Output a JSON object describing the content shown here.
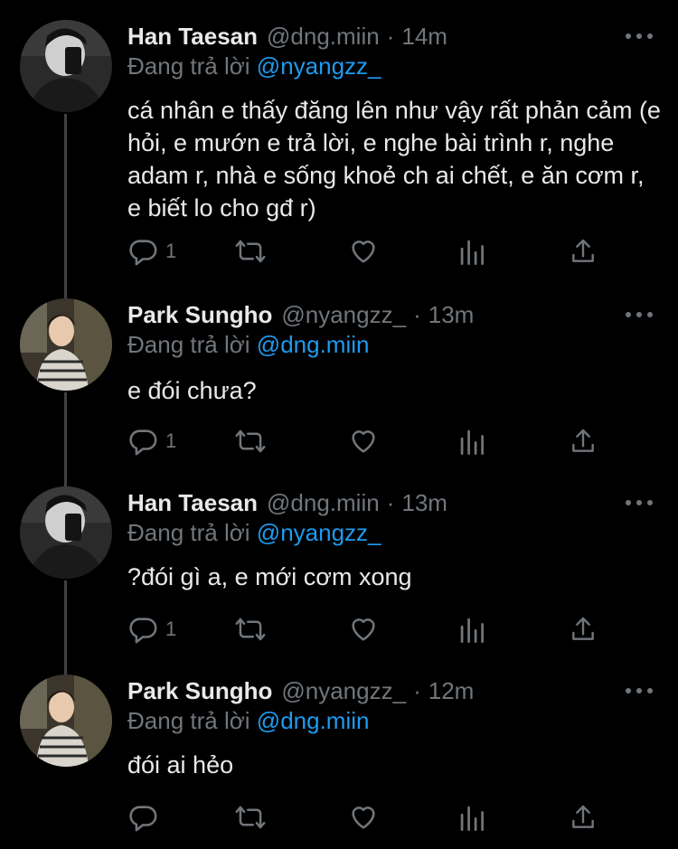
{
  "tweets": [
    {
      "name": "Han Taesan",
      "handle": "@dng.miin",
      "time": "14m",
      "reply_prefix": "Đang trả lời",
      "reply_to": "@nyangzz_",
      "text": "cá nhân e thấy đăng lên như vậy rất phản cảm (e hỏi, e mướn e trả lời, e nghe bài trình r, nghe adam r, nhà e sống khoẻ ch ai chết, e ăn cơm r, e biết lo cho gđ r)",
      "reply_count": "1"
    },
    {
      "name": "Park Sungho",
      "handle": "@nyangzz_",
      "time": "13m",
      "reply_prefix": "Đang trả lời",
      "reply_to": "@dng.miin",
      "text": "e đói chưa?",
      "reply_count": "1"
    },
    {
      "name": "Han Taesan",
      "handle": "@dng.miin",
      "time": "13m",
      "reply_prefix": "Đang trả lời",
      "reply_to": "@nyangzz_",
      "text": "?đói gì a, e mới cơm xong",
      "reply_count": "1"
    },
    {
      "name": "Park Sungho",
      "handle": "@nyangzz_",
      "time": "12m",
      "reply_prefix": "Đang trả lời",
      "reply_to": "@dng.miin",
      "text": "đói ai hẻo",
      "reply_count": ""
    }
  ],
  "separator": "·",
  "colors": {
    "accent": "#1d9bf0",
    "muted": "#71767b",
    "text": "#e7e9ea",
    "background": "#000000"
  },
  "icons": [
    "reply-icon",
    "retweet-icon",
    "like-icon",
    "analytics-icon",
    "share-icon",
    "more-icon"
  ]
}
